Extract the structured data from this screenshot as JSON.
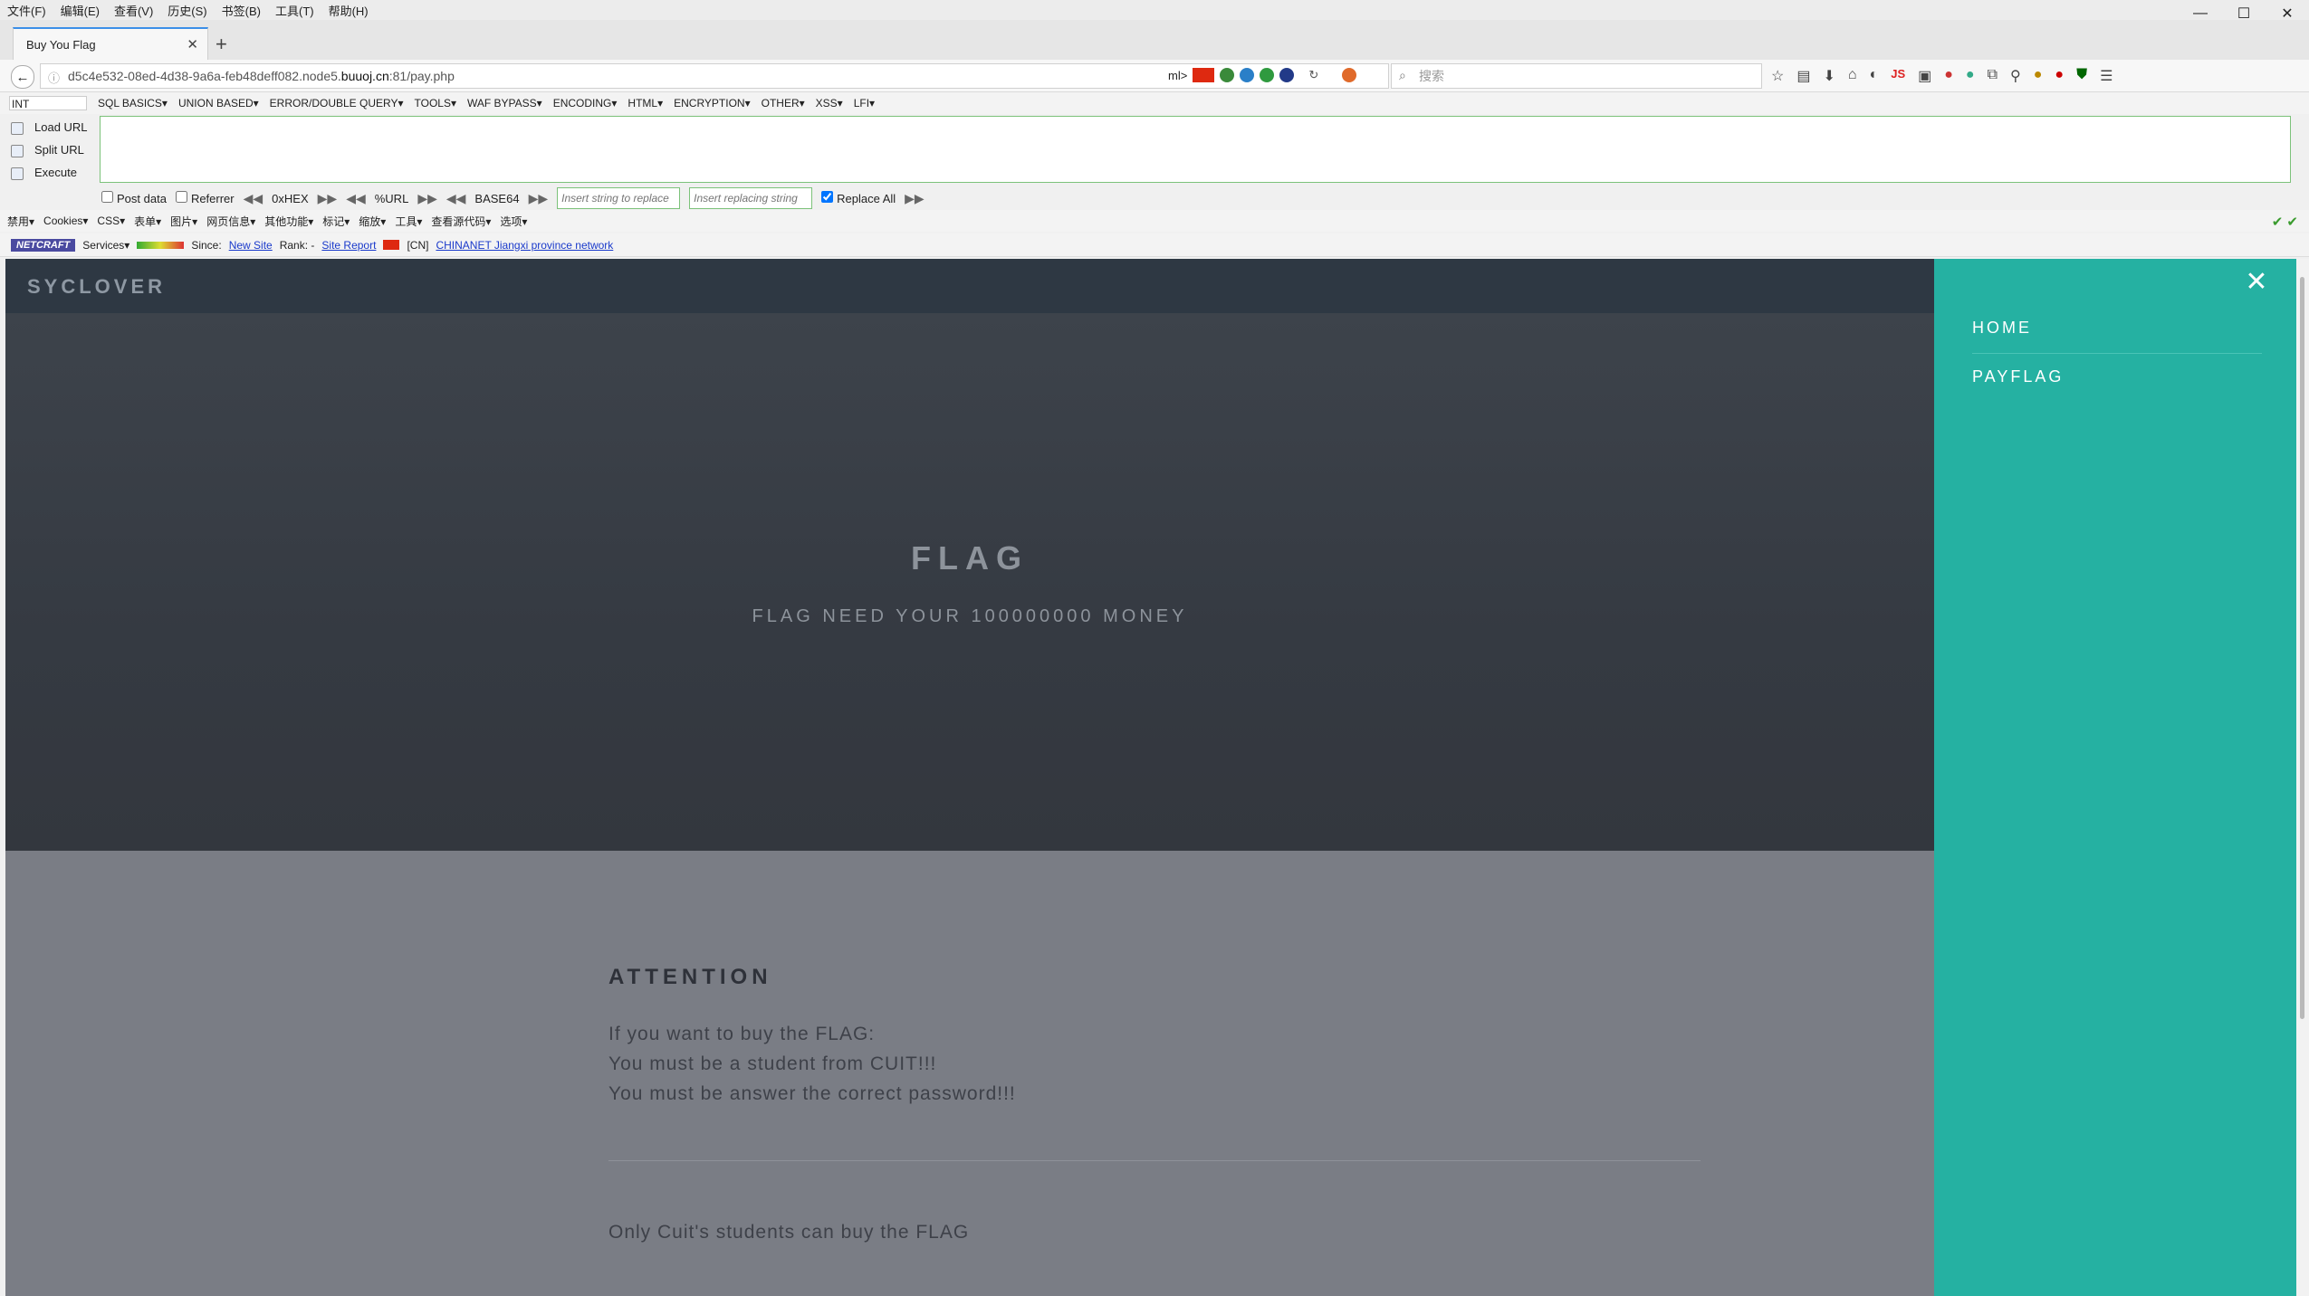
{
  "menubar": [
    "文件(F)",
    "编辑(E)",
    "查看(V)",
    "历史(S)",
    "书签(B)",
    "工具(T)",
    "帮助(H)"
  ],
  "window_controls": {
    "minimize": "—",
    "maximize": "☐",
    "close": "✕"
  },
  "tab": {
    "title": "Buy You Flag",
    "close": "✕",
    "new_tab": "+"
  },
  "nav": {
    "url_prefix": "d5c4e532-08ed-4d38-9a6a-feb48deff082.node5.",
    "url_domain": "buuoj.cn",
    "url_suffix": ":81/pay.php",
    "ext_text": "ml>",
    "search_placeholder": "搜索"
  },
  "hackbar": {
    "select_value": "INT",
    "menu": [
      "SQL BASICS▾",
      "UNION BASED▾",
      "ERROR/DOUBLE QUERY▾",
      "TOOLS▾",
      "WAF BYPASS▾",
      "ENCODING▾",
      "HTML▾",
      "ENCRYPTION▾",
      "OTHER▾",
      "XSS▾",
      "LFI▾"
    ],
    "load_url": "Load URL",
    "split_url": "Split URL",
    "execute": "Execute",
    "post_data": "Post data",
    "referrer": "Referrer",
    "hex": "0xHEX",
    "url": "%URL",
    "base64": "BASE64",
    "insert_placeholder": "Insert string to replace",
    "replacing_placeholder": "Insert replacing string",
    "replace_all": "Replace All"
  },
  "webdev": [
    "禁用▾",
    "Cookies▾",
    "CSS▾",
    "表单▾",
    "图片▾",
    "网页信息▾",
    "其他功能▾",
    "标记▾",
    "缩放▾",
    "工具▾",
    "查看源代码▾",
    "选项▾"
  ],
  "netcraft": {
    "logo": "NETCRAFT",
    "services": "Services▾",
    "since_label": "Since:",
    "since_link": "New Site",
    "rank_label": "Rank: -",
    "site_report": "Site Report",
    "country": "[CN]",
    "network": "CHINANET Jiangxi province network"
  },
  "page": {
    "logo": "SYCLOVER",
    "banner_title": "FLAG",
    "banner_subtitle": "FLAG NEED YOUR 100000000 MONEY",
    "attention_title": "ATTENTION",
    "attention_lines": [
      "If you want to buy the FLAG:",
      "You must be a student from CUIT!!!",
      "You must be answer the correct password!!!"
    ],
    "note": "Only Cuit's students can buy the FLAG",
    "side_menu": {
      "close": "✕",
      "items": [
        "HOME",
        "PAYFLAG"
      ]
    }
  },
  "colors": {
    "header_bg": "#2e3843",
    "banner_bg": "#3a3f47",
    "main_bg": "#7a7d85",
    "side_panel": "#25b1a2"
  }
}
